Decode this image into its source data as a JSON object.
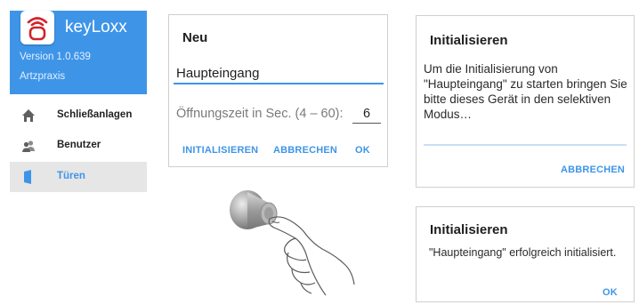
{
  "drawer": {
    "app_name": "keyLoxx",
    "version": "Version 1.0.639",
    "account": "Artzpraxis",
    "items": [
      {
        "label": "Schließanlagen",
        "icon": "home-icon",
        "active": false
      },
      {
        "label": "Benutzer",
        "icon": "users-icon",
        "active": false
      },
      {
        "label": "Türen",
        "icon": "door-icon",
        "active": true
      }
    ],
    "accent_color": "#3e95e8",
    "logo_color": "#d0252b"
  },
  "dialog_new": {
    "title": "Neu",
    "name_value": "Haupteingang",
    "opening_label": "Öffnungszeit in Sec. (4 – 60):",
    "opening_value": "6",
    "buttons": {
      "initialize": "INITIALISIEREN",
      "cancel": "ABBRECHEN",
      "ok": "OK"
    }
  },
  "dialog_init": {
    "title": "Initialisieren",
    "message": "Um die Initialisierung von \"Haupteingang\" zu starten bringen Sie bitte dieses Gerät in den selektiven Modus…",
    "cancel": "ABBRECHEN"
  },
  "dialog_done": {
    "title": "Initialisieren",
    "message": "\"Haupteingang\" erfolgreich initialisiert.",
    "ok": "OK"
  },
  "illustration": {
    "icon": "hand-touching-lock-cylinder-icon"
  }
}
